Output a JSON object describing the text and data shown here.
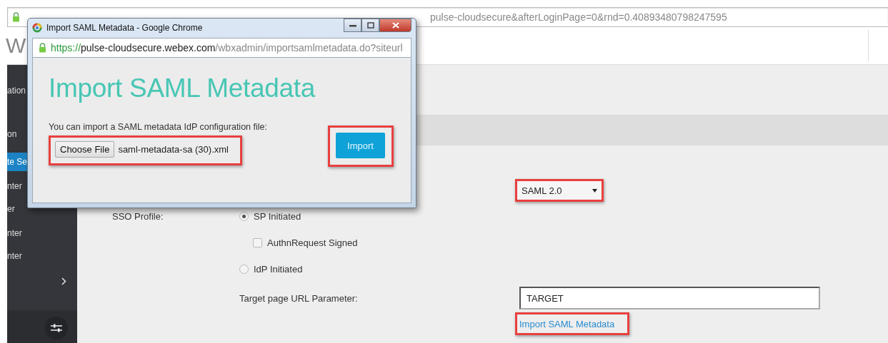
{
  "browser": {
    "address": "pulse-cloudsecure&afterLoginPage=0&rnd=0.40893480798247595",
    "logo_text": "W"
  },
  "sidebar": {
    "items": [
      {
        "label": "ation",
        "selected": false
      },
      {
        "label": "on",
        "selected": false
      },
      {
        "label": "te Se",
        "selected": true
      },
      {
        "label": "nter",
        "selected": false
      },
      {
        "label": "er",
        "selected": false
      },
      {
        "label": "nter",
        "selected": false
      },
      {
        "label": "nter",
        "selected": false
      }
    ]
  },
  "form": {
    "protocol_select": {
      "value": "SAML 2.0",
      "highlighted": true
    },
    "sso_profile": {
      "label": "SSO Profile:",
      "options": [
        {
          "kind": "radio",
          "label": "SP Initiated",
          "selected": true
        },
        {
          "kind": "checkbox",
          "label": "AuthnRequest Signed",
          "checked": false
        },
        {
          "kind": "radio",
          "label": "IdP Initiated",
          "selected": false
        }
      ]
    },
    "target": {
      "label": "Target page URL Parameter:",
      "value": "TARGET"
    },
    "import_link": {
      "label": "Import SAML Metadata",
      "highlighted": true
    }
  },
  "popup": {
    "title": "Import SAML Metadata - Google Chrome",
    "url_scheme": "https://",
    "url_host": "pulse-cloudsecure.webex.com",
    "url_path": "/wbxadmin/importsamlmetadata.do?siteurl",
    "heading": "Import SAML Metadata",
    "prompt": "You can import a SAML metadata IdP configuration file:",
    "file_button": "Choose File",
    "file_name": "saml-metadata-sa (30).xml",
    "file_highlighted": true,
    "import_button": "Import",
    "import_highlighted": true
  }
}
